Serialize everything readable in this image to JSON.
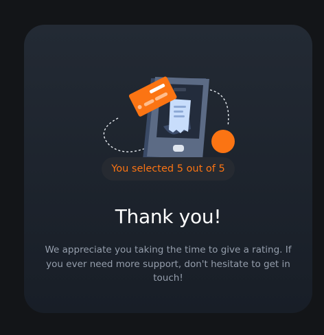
{
  "badge": {
    "text": "You selected 5 out of 5",
    "color": "#fb7413"
  },
  "heading": {
    "title": "Thank you!"
  },
  "message": {
    "text": "We appreciate you taking the time to give a rating. If you ever need more support, don't hesitate to get in touch!"
  },
  "illustration": {
    "icon": "phone-payment-illustration"
  },
  "colors": {
    "page_background": "#131518",
    "card_background": "#1b222b",
    "accent": "#fb7413",
    "title": "#ffffff",
    "body_text": "#969fad"
  }
}
